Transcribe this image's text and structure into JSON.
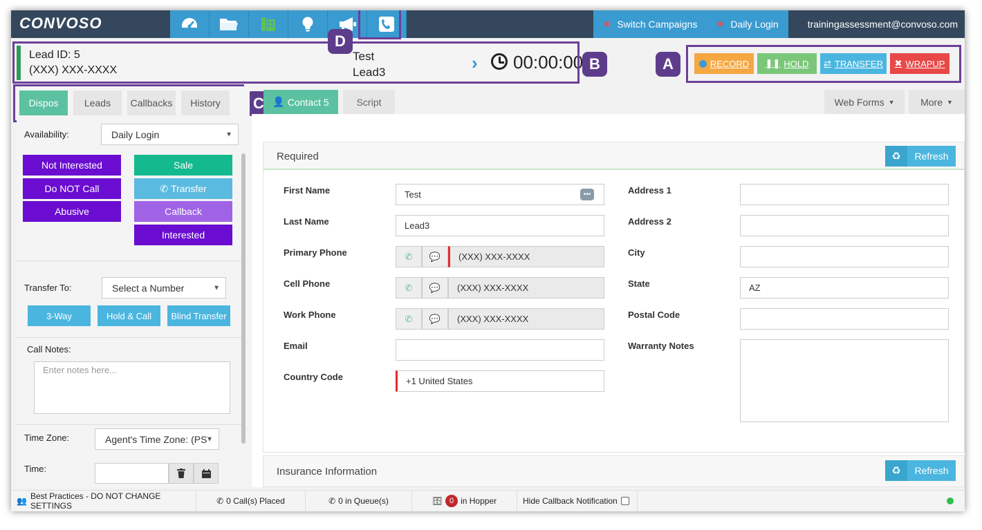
{
  "brand": {
    "logo": "CONVOSO"
  },
  "nav": {
    "icons": [
      "dashboard-icon",
      "folder-icon",
      "phone-book-icon",
      "lightbulb-icon",
      "megaphone-icon",
      "phone-icon"
    ]
  },
  "top_right": {
    "switch_campaigns": "Switch Campaigns",
    "daily_login": "Daily Login",
    "user_email": "trainingassessment@convoso.com"
  },
  "lead": {
    "id_label": "Lead ID: 5",
    "phone": "(XXX) XXX-XXXX",
    "first": "Test",
    "last": "Lead3",
    "timer": "00:00:00"
  },
  "actions": {
    "record": "RECORD",
    "hold": "HOLD",
    "transfer": "TRANSFER",
    "wrapup": "WRAPUP"
  },
  "callouts": {
    "a": "A",
    "b": "B",
    "c": "C",
    "d": "D"
  },
  "left_tabs": {
    "dispos": "Dispos",
    "leads": "Leads",
    "callbacks": "Callbacks",
    "history": "History"
  },
  "availability": {
    "label": "Availability:",
    "value": "Daily Login"
  },
  "dispos": {
    "left": [
      "Not Interested",
      "Do NOT Call",
      "Abusive"
    ],
    "right": [
      "Sale",
      "Transfer",
      "Callback",
      "Interested"
    ]
  },
  "transfer": {
    "label": "Transfer To:",
    "select": "Select a Number",
    "three_way": "3-Way",
    "hold_call": "Hold & Call",
    "blind": "Blind Transfer"
  },
  "notes": {
    "label": "Call Notes:",
    "placeholder": "Enter notes here..."
  },
  "timezone": {
    "label": "Time Zone:",
    "value": "Agent's Time Zone: (PST"
  },
  "time": {
    "label": "Time:"
  },
  "main_tabs": {
    "contact": "Contact 5",
    "script": "Script",
    "web_forms": "Web Forms",
    "more": "More"
  },
  "required": {
    "title": "Required",
    "refresh": "Refresh",
    "left": [
      {
        "label": "First Name",
        "value": "Test"
      },
      {
        "label": "Last Name",
        "value": "Lead3"
      },
      {
        "label": "Primary Phone",
        "value": "(XXX) XXX-XXXX"
      },
      {
        "label": "Cell Phone",
        "value": "(XXX) XXX-XXXX"
      },
      {
        "label": "Work Phone",
        "value": "(XXX) XXX-XXXX"
      },
      {
        "label": "Email",
        "value": ""
      },
      {
        "label": "Country Code",
        "value": "+1 United States"
      }
    ],
    "right": [
      {
        "label": "Address 1",
        "value": ""
      },
      {
        "label": "Address 2",
        "value": ""
      },
      {
        "label": "City",
        "value": ""
      },
      {
        "label": "State",
        "value": "AZ"
      },
      {
        "label": "Postal Code",
        "value": ""
      },
      {
        "label": "Warranty Notes",
        "value": ""
      }
    ]
  },
  "insurance": {
    "title": "Insurance Information",
    "refresh": "Refresh"
  },
  "status": {
    "best_practices": "Best Practices - DO NOT CHANGE SETTINGS",
    "calls_placed": "0 Call(s) Placed",
    "in_queue": "0 in Queue(s)",
    "hopper_count": "0",
    "in_hopper": "in Hopper",
    "hide_callback": "Hide Callback Notification"
  }
}
